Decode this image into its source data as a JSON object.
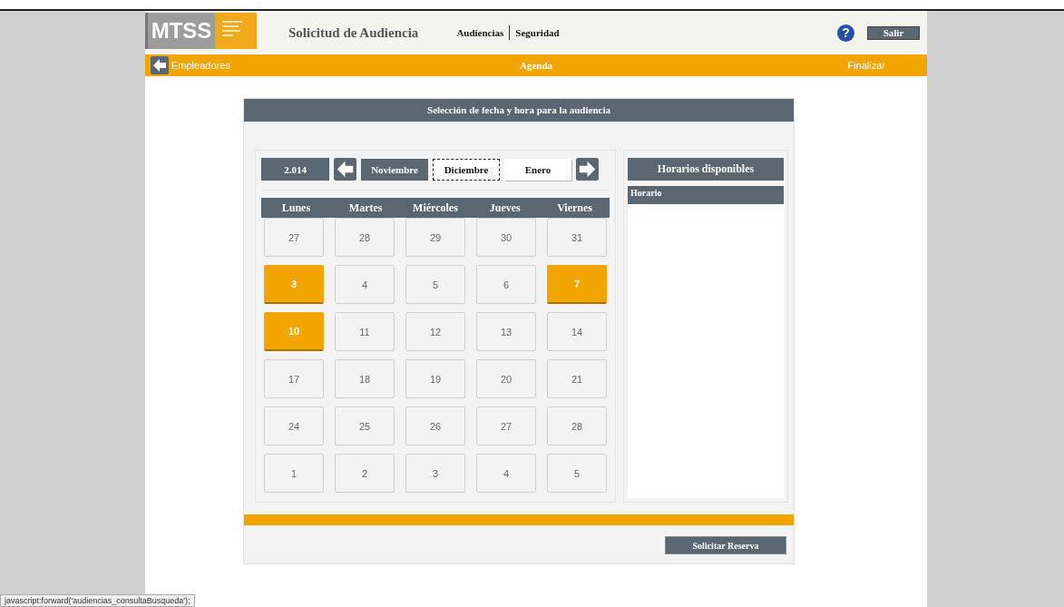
{
  "header": {
    "logo": "MTSS",
    "title": "Solicitud de Audiencia",
    "menu": [
      "Audiencias",
      "Seguridad"
    ],
    "help": "?",
    "logout": "Salir"
  },
  "nav_bar": {
    "back": "Empleadores",
    "title": "Agenda",
    "finish": "Finalizar"
  },
  "panel": {
    "title": "Selección de fecha y hora para la audiencia",
    "year": "2.014",
    "months": [
      {
        "label": "Noviembre",
        "selected": false,
        "kind": "past"
      },
      {
        "label": "Diciembre",
        "selected": true,
        "kind": "current"
      },
      {
        "label": "Enero",
        "selected": false,
        "kind": "next"
      }
    ],
    "weekdays": [
      "Lunes",
      "Martes",
      "Miércoles",
      "Jueves",
      "Viernes"
    ],
    "weeks": [
      [
        {
          "day": "27",
          "available": false
        },
        {
          "day": "28",
          "available": false
        },
        {
          "day": "29",
          "available": false
        },
        {
          "day": "30",
          "available": false
        },
        {
          "day": "31",
          "available": false
        }
      ],
      [
        {
          "day": "3",
          "available": true
        },
        {
          "day": "4",
          "available": false
        },
        {
          "day": "5",
          "available": false
        },
        {
          "day": "6",
          "available": false
        },
        {
          "day": "7",
          "available": true
        }
      ],
      [
        {
          "day": "10",
          "available": true
        },
        {
          "day": "11",
          "available": false
        },
        {
          "day": "12",
          "available": false
        },
        {
          "day": "13",
          "available": false
        },
        {
          "day": "14",
          "available": false
        }
      ],
      [
        {
          "day": "17",
          "available": false
        },
        {
          "day": "18",
          "available": false
        },
        {
          "day": "19",
          "available": false
        },
        {
          "day": "20",
          "available": false
        },
        {
          "day": "21",
          "available": false
        }
      ],
      [
        {
          "day": "24",
          "available": false
        },
        {
          "day": "25",
          "available": false
        },
        {
          "day": "26",
          "available": false
        },
        {
          "day": "27",
          "available": false
        },
        {
          "day": "28",
          "available": false
        }
      ],
      [
        {
          "day": "1",
          "available": false
        },
        {
          "day": "2",
          "available": false
        },
        {
          "day": "3",
          "available": false
        },
        {
          "day": "4",
          "available": false
        },
        {
          "day": "5",
          "available": false
        }
      ]
    ],
    "schedule_title": "Horarios disponibles",
    "schedule_column": "Horario",
    "submit": "Solicitar Reserva"
  },
  "status_bar": "javascript:forward('audiencias_consultaBusqueda');"
}
